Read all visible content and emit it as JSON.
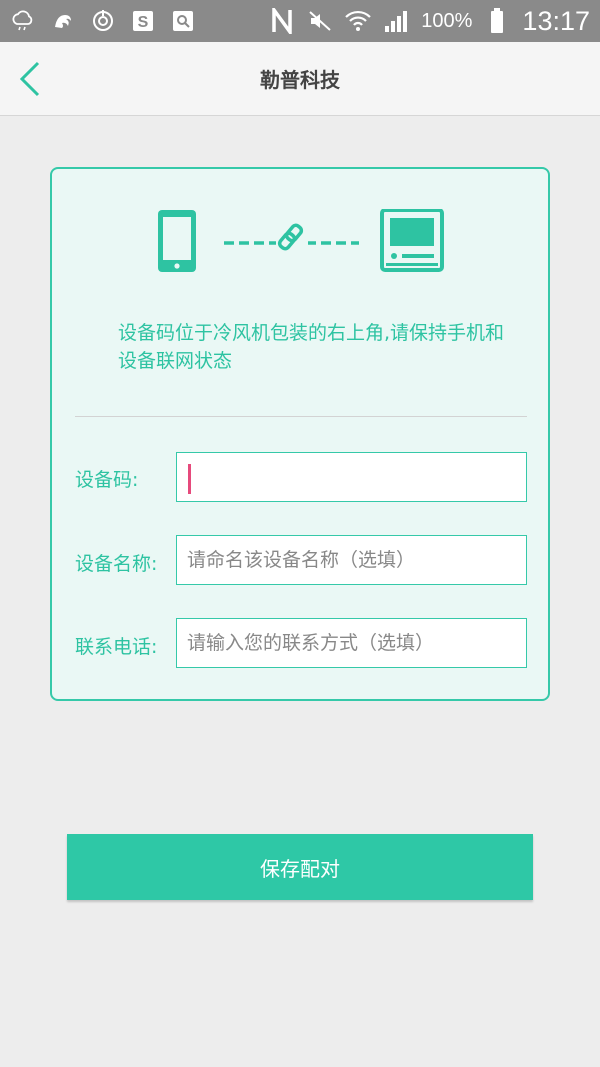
{
  "status_bar": {
    "icons": [
      "cloud-rain-icon",
      "uc-browser-icon",
      "sync-icon",
      "s-app-icon",
      "image-search-icon",
      "nfc-icon",
      "mute-icon",
      "wifi-icon",
      "signal-icon"
    ],
    "battery": "100%",
    "time": "13:17"
  },
  "header": {
    "title": "勒普科技",
    "back_icon": "chevron-left-icon"
  },
  "card": {
    "illustration": {
      "left_icon": "phone-icon",
      "link_icon": "link-icon",
      "right_icon": "air-cooler-icon"
    },
    "hint": "设备码位于冷风机包装的右上角,请保持手机和设备联网状态",
    "fields": {
      "device_code": {
        "label": "设备码:",
        "value": "",
        "placeholder": ""
      },
      "device_name": {
        "label": "设备名称:",
        "value": "",
        "placeholder": "请命名该设备名称（选填）"
      },
      "contact_phone": {
        "label": "联系电话:",
        "value": "",
        "placeholder": "请输入您的联系方式（选填）"
      }
    }
  },
  "save_button": {
    "label": "保存配对"
  },
  "colors": {
    "accent": "#2ec8a6",
    "card_bg": "#eaf8f5",
    "status_bar": "#8a8a8a",
    "caret": "#e64a7c"
  }
}
